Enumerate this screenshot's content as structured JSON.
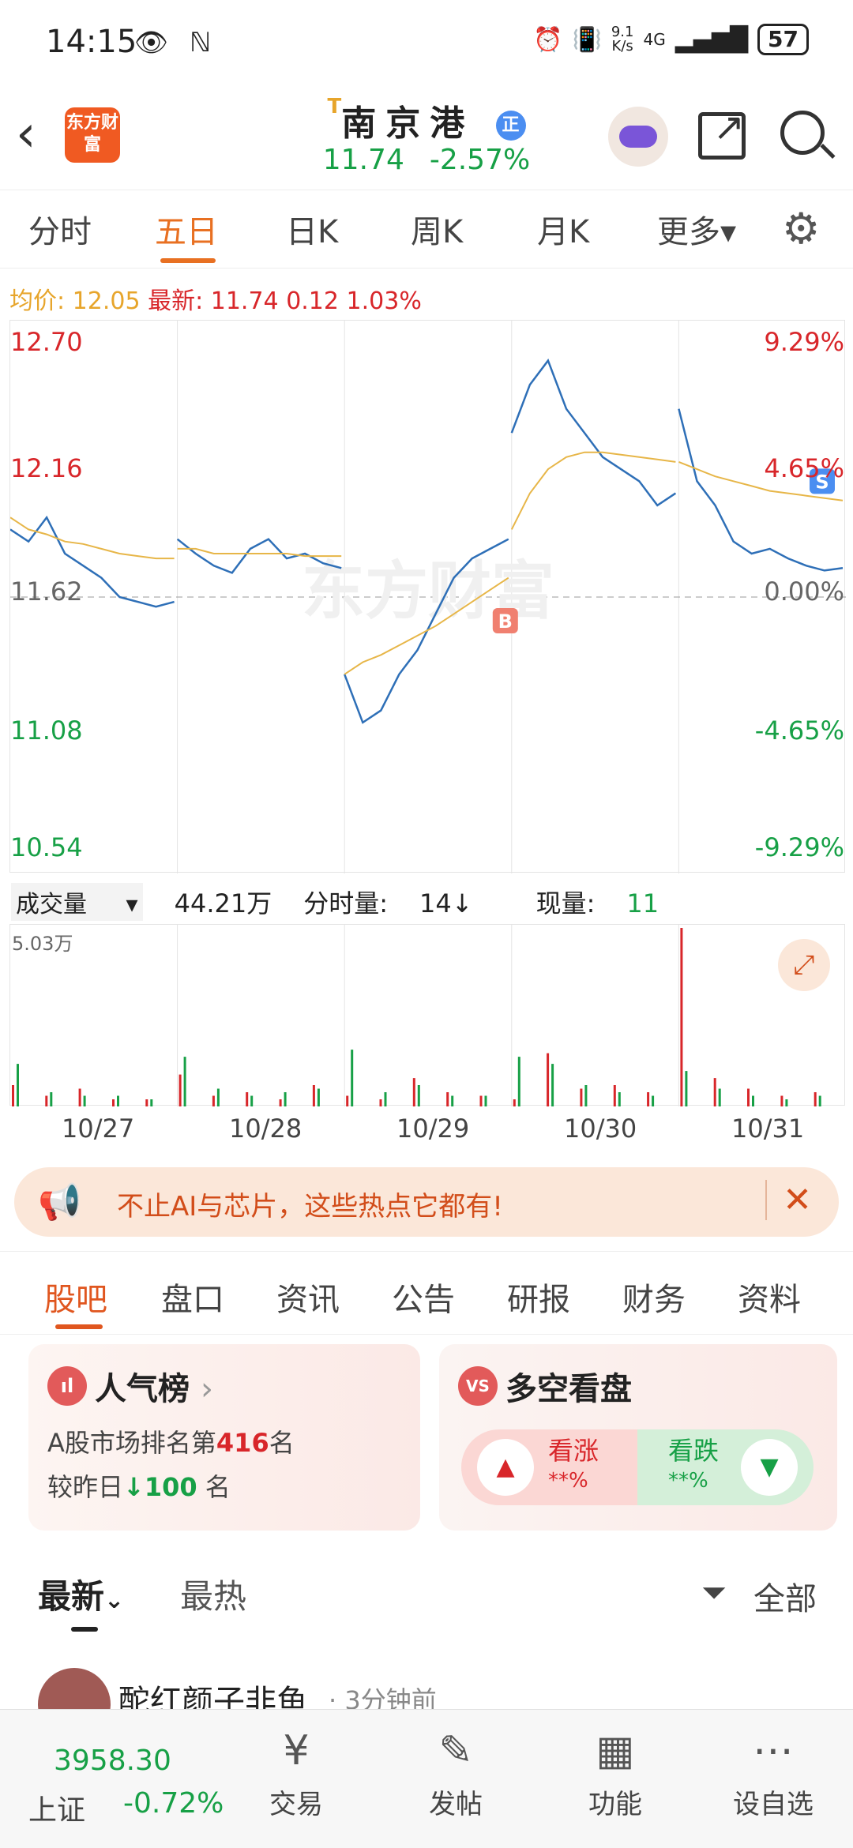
{
  "status": {
    "time": "14:15",
    "left_icons": "👁 ℕ",
    "speed_value": "9.1",
    "speed_unit": "K/s",
    "network": "4G",
    "battery": "57"
  },
  "header": {
    "back_icon": "back-chevron-icon",
    "logo_text": "东方财富",
    "t_mark": "T",
    "stock_name": "南京港",
    "badge": "正",
    "price": "11.74",
    "change_pct": "-2.57%"
  },
  "period_tabs": [
    "分时",
    "五日",
    "日K",
    "周K",
    "月K",
    "更多▾"
  ],
  "active_period": "五日",
  "info_line": {
    "avg_label": "均价:",
    "avg_value": "12.05",
    "latest_label": "最新:",
    "latest_value": "11.74",
    "diff": "0.12",
    "diff_pct": "1.03%"
  },
  "chart_data": [
    {
      "type": "line",
      "y_left_ticks": [
        "12.70",
        "12.16",
        "11.62",
        "11.08",
        "10.54"
      ],
      "y_right_ticks": [
        "9.29%",
        "4.65%",
        "0.00%",
        "-4.65%",
        "-9.29%"
      ],
      "ylim": [
        10.54,
        12.7
      ],
      "baseline": 11.62,
      "days": [
        "10/27",
        "10/28",
        "10/29",
        "10/30",
        "10/31"
      ],
      "series": [
        {
          "name": "",
          "color": "#2e6fb7",
          "values": [
            11.9,
            11.85,
            11.95,
            11.8,
            11.75,
            11.7,
            11.62,
            11.6,
            11.58,
            11.6,
            11.86,
            11.8,
            11.75,
            11.72,
            11.82,
            11.86,
            11.78,
            11.8,
            11.76,
            11.74,
            11.3,
            11.1,
            11.15,
            11.3,
            11.4,
            11.55,
            11.7,
            11.78,
            11.82,
            11.86,
            12.3,
            12.5,
            12.6,
            12.4,
            12.3,
            12.2,
            12.15,
            12.1,
            12.0,
            12.05,
            12.4,
            12.1,
            12.0,
            11.85,
            11.8,
            11.82,
            11.78,
            11.75,
            11.73,
            11.74
          ]
        },
        {
          "name": "",
          "color": "#e7b648",
          "values": [
            11.95,
            11.9,
            11.88,
            11.85,
            11.84,
            11.82,
            11.8,
            11.79,
            11.78,
            11.78,
            11.82,
            11.82,
            11.8,
            11.8,
            11.8,
            11.8,
            11.8,
            11.79,
            11.79,
            11.79,
            11.3,
            11.35,
            11.38,
            11.42,
            11.46,
            11.5,
            11.55,
            11.6,
            11.65,
            11.7,
            11.9,
            12.05,
            12.15,
            12.2,
            12.22,
            12.22,
            12.21,
            12.2,
            12.19,
            12.18,
            12.18,
            12.15,
            12.12,
            12.1,
            12.08,
            12.06,
            12.05,
            12.04,
            12.03,
            12.02
          ]
        }
      ],
      "markers": [
        {
          "label": "B",
          "day": "10/29",
          "color": "#f08070"
        },
        {
          "label": "S",
          "day": "10/31",
          "color": "#4b8ef1"
        }
      ],
      "watermark": "东方财富"
    },
    {
      "type": "bar",
      "title": "",
      "ymax_label": "5.03万",
      "ymax": 5.03,
      "categories": [
        "10/27",
        "10/28",
        "10/29",
        "10/30",
        "10/31"
      ],
      "series": [
        {
          "name": "",
          "color": "#d8262a",
          "values": [
            0.6,
            0.3,
            0.5,
            0.2,
            0.2,
            0.9,
            0.3,
            0.4,
            0.2,
            0.6,
            0.3,
            0.2,
            0.8,
            0.4,
            0.3,
            0.2,
            1.5,
            0.5,
            0.6,
            0.4,
            5.03,
            0.8,
            0.5,
            0.3,
            0.4
          ]
        },
        {
          "name": "",
          "color": "#17a046",
          "values": [
            1.2,
            0.4,
            0.3,
            0.3,
            0.2,
            1.4,
            0.5,
            0.3,
            0.4,
            0.5,
            1.6,
            0.4,
            0.6,
            0.3,
            0.3,
            1.4,
            1.2,
            0.6,
            0.4,
            0.3,
            1.0,
            0.5,
            0.3,
            0.2,
            0.3
          ]
        }
      ]
    }
  ],
  "volume_info": {
    "selector": "成交量",
    "total": "44.21万",
    "tick_label": "分时量:",
    "tick_value": "14↓",
    "current_label": "现量:",
    "current_value": "11"
  },
  "promo": {
    "text": "不止AI与芯片，这些热点它都有!",
    "icon": "megaphone-icon",
    "close": "✕"
  },
  "section_tabs": [
    "股吧",
    "盘口",
    "资讯",
    "公告",
    "研报",
    "财务",
    "资料"
  ],
  "active_section": "股吧",
  "popularity_card": {
    "icon_text": "ıl",
    "title": "人气榜",
    "chevron": "›",
    "rank_prefix": "A股市场排名第",
    "rank_value": "416",
    "rank_suffix": "名",
    "compare_prefix": "较昨日",
    "compare_arrow": "↓",
    "compare_value": "100",
    "compare_suffix": " 名"
  },
  "sentiment_card": {
    "icon_text": "VS",
    "title": "多空看盘",
    "up_label": "看涨",
    "up_pct": "**%",
    "down_label": "看跌",
    "down_pct": "**%",
    "up_btn": "▲",
    "down_btn": "▼"
  },
  "post_filter": {
    "latest": "最新",
    "latest_chevron": "⌄",
    "hot": "最热",
    "all": "全部",
    "funnel": "⏷"
  },
  "post_preview": {
    "author": "酡红颜子非鱼",
    "time": "· 3分钟前"
  },
  "bottom_nav": {
    "index_value": "3958.30",
    "index_name": "上证",
    "index_change": "-0.72%",
    "items": [
      {
        "label": "交易",
        "icon": "¥"
      },
      {
        "label": "发帖",
        "icon": "✎"
      },
      {
        "label": "功能",
        "icon": "▦"
      },
      {
        "label": "设自选",
        "icon": "⋯"
      }
    ]
  }
}
